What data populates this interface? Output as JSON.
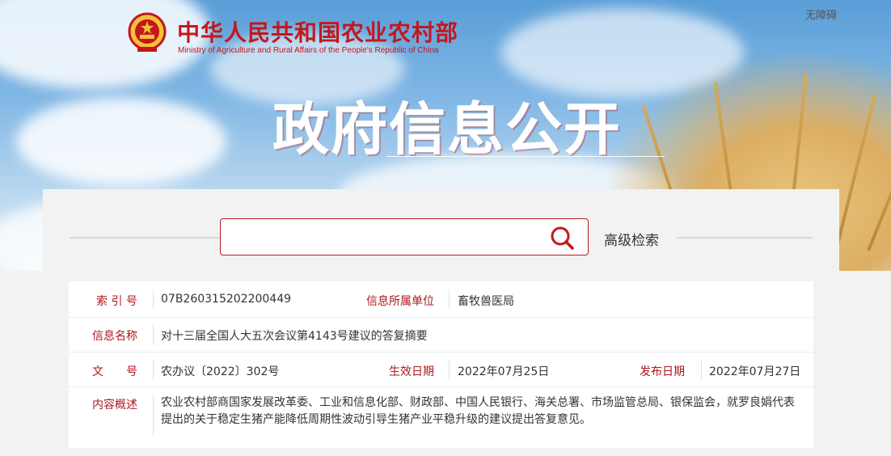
{
  "header": {
    "ministry_cn": "中华人民共和国农业农村部",
    "ministry_en": "Ministry of Agriculture and Rural Affairs of the People's Republic of China",
    "accessibility": "无障碍",
    "banner_title": "政府信息公开",
    "logo_icon": "national-emblem-icon"
  },
  "search": {
    "placeholder": "",
    "value": "",
    "search_icon": "search-icon",
    "advanced_label": "高级检索"
  },
  "info": {
    "index_label": "索 引 号",
    "index_value": "07B260315202200449",
    "unit_label": "信息所属单位",
    "unit_value": "畜牧兽医局",
    "name_label": "信息名称",
    "name_value": "对十三届全国人大五次会议第4143号建议的答复摘要",
    "docno_label": "文　　号",
    "docno_value": "农办议〔2022〕302号",
    "effective_label": "生效日期",
    "effective_value": "2022年07月25日",
    "publish_label": "发布日期",
    "publish_value": "2022年07月27日",
    "summary_label": "内容概述",
    "summary_value": "农业农村部商国家发展改革委、工业和信息化部、财政部、中国人民银行、海关总署、市场监管总局、银保监会，就罗良娟代表提出的关于稳定生猪产能降低周期性波动引导生猪产业平稳升级的建议提出答复意见。"
  },
  "colors": {
    "brand_red": "#c3171d",
    "label_red": "#b1161c",
    "sky_blue": "#5a9ed8",
    "panel_bg": "#f2f2f2"
  }
}
